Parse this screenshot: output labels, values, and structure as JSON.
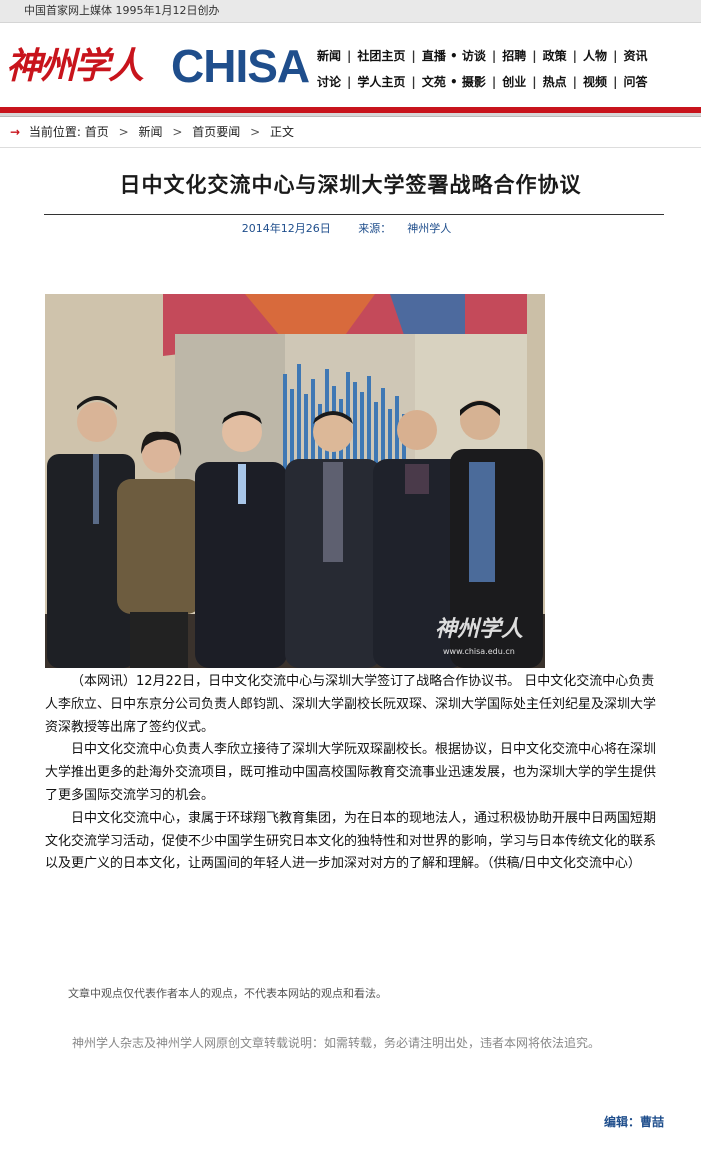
{
  "topbar": {
    "text": "中国首家网上媒体  1995年1月12日创办"
  },
  "logo": {
    "chinese": "神州学人",
    "english": "CHISA"
  },
  "nav": {
    "row1": [
      "新闻",
      "社团主页",
      "直播 • 访谈",
      "招聘",
      "政策",
      "人物",
      "资讯"
    ],
    "row2": [
      "讨论",
      "学人主页",
      "文苑 • 摄影",
      "创业",
      "热点",
      "视频",
      "问答"
    ],
    "separator": "|"
  },
  "breadcrumb": {
    "prefix": "当前位置:",
    "items": [
      "首页",
      "新闻",
      "首页要闻",
      "正文"
    ],
    "separator": ">"
  },
  "article": {
    "title": "日中文化交流中心与深圳大学签署战略合作协议",
    "date": "2014年12月26日",
    "source_label": "来源：",
    "source": "神州学人",
    "photo_watermark_cn": "神州学人",
    "photo_watermark_url": "www.chisa.edu.cn",
    "paragraphs": [
      "（本网讯）12月22日，日中文化交流中心与深圳大学签订了战略合作协议书。 日中文化交流中心负责人李欣立、日中东京分公司负责人郎钧凯、深圳大学副校长阮双琛、深圳大学国际处主任刘纪星及深圳大学资深教授等出席了签约仪式。",
      "日中文化交流中心负责人李欣立接待了深圳大学阮双琛副校长。根据协议，日中文化交流中心将在深圳大学推出更多的赴海外交流项目，既可推动中国高校国际教育交流事业迅速发展，也为深圳大学的学生提供了更多国际交流学习的机会。",
      "日中文化交流中心，隶属于环球翔飞教育集团，为在日本的现地法人，通过积极协助开展中日两国短期文化交流学习活动，促使不少中国学生研究日本文化的独特性和对世界的影响，学习与日本传统文化的联系以及更广义的日本文化，让两国间的年轻人进一步加深对对方的了解和理解。（供稿/日中文化交流中心）"
    ],
    "disclaimer": "文章中观点仅代表作者本人的观点，不代表本网站的观点和看法。",
    "reprint_notice": "神州学人杂志及神州学人网原创文章转载说明：如需转载，务必请注明出处，违者本网将依法追究。",
    "editor_label": "编辑：",
    "editor": "曹喆"
  },
  "colors": {
    "brand_red": "#c8141c",
    "brand_blue": "#1f4e8c"
  }
}
